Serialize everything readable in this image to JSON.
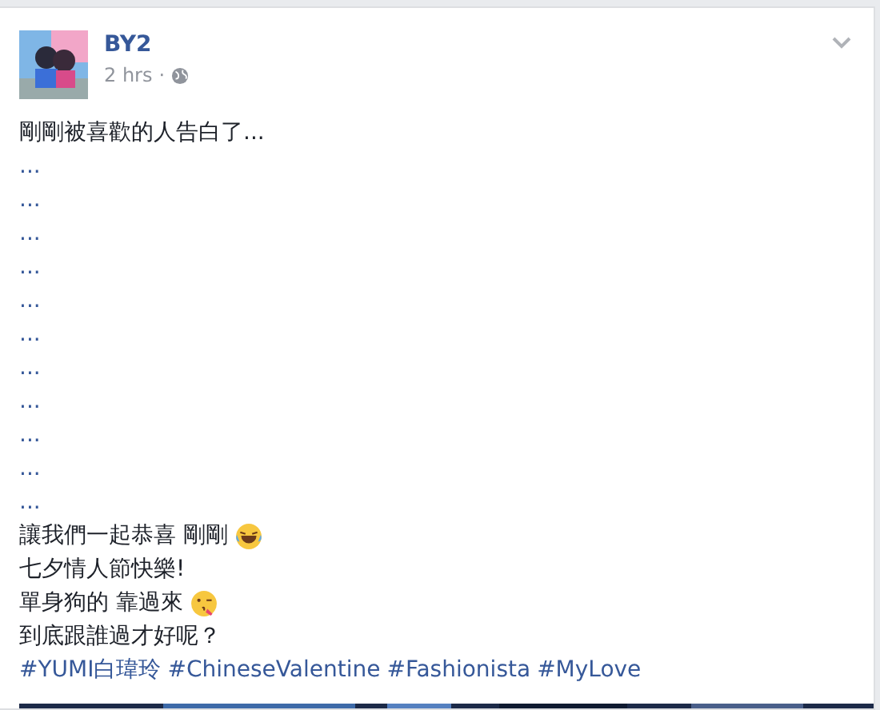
{
  "post": {
    "author": "BY2",
    "time": "2 hrs",
    "separator": "·",
    "lines": [
      {
        "parts": [
          {
            "kind": "text",
            "text": "剛剛被喜歡的人告白了..."
          }
        ]
      },
      {
        "parts": [
          {
            "kind": "link",
            "text": "..."
          }
        ]
      },
      {
        "parts": [
          {
            "kind": "link",
            "text": "..."
          }
        ]
      },
      {
        "parts": [
          {
            "kind": "link",
            "text": "..."
          }
        ]
      },
      {
        "parts": [
          {
            "kind": "link",
            "text": "..."
          }
        ]
      },
      {
        "parts": [
          {
            "kind": "link",
            "text": "..."
          }
        ]
      },
      {
        "parts": [
          {
            "kind": "link",
            "text": "..."
          }
        ]
      },
      {
        "parts": [
          {
            "kind": "link",
            "text": "..."
          }
        ]
      },
      {
        "parts": [
          {
            "kind": "link",
            "text": "..."
          }
        ]
      },
      {
        "parts": [
          {
            "kind": "link",
            "text": "..."
          }
        ]
      },
      {
        "parts": [
          {
            "kind": "link",
            "text": "..."
          }
        ]
      },
      {
        "parts": [
          {
            "kind": "link",
            "text": "..."
          }
        ]
      },
      {
        "parts": [
          {
            "kind": "text",
            "text": "讓我們一起恭喜 剛剛"
          },
          {
            "kind": "laughing-emoji"
          }
        ]
      },
      {
        "parts": [
          {
            "kind": "text",
            "text": "七夕情人節快樂!"
          }
        ]
      },
      {
        "parts": [
          {
            "kind": "text",
            "text": "單身狗的 靠過來"
          },
          {
            "kind": "kiss-emoji"
          }
        ]
      },
      {
        "parts": [
          {
            "kind": "text",
            "text": "到底跟誰過才好呢？"
          }
        ]
      },
      {
        "parts": [
          {
            "kind": "link",
            "text": "#YUMI白瑋玲"
          },
          {
            "kind": "link",
            "text": "#ChineseValentine"
          },
          {
            "kind": "link",
            "text": "#Fashionista"
          },
          {
            "kind": "link",
            "text": "#MyLove"
          }
        ]
      }
    ]
  }
}
